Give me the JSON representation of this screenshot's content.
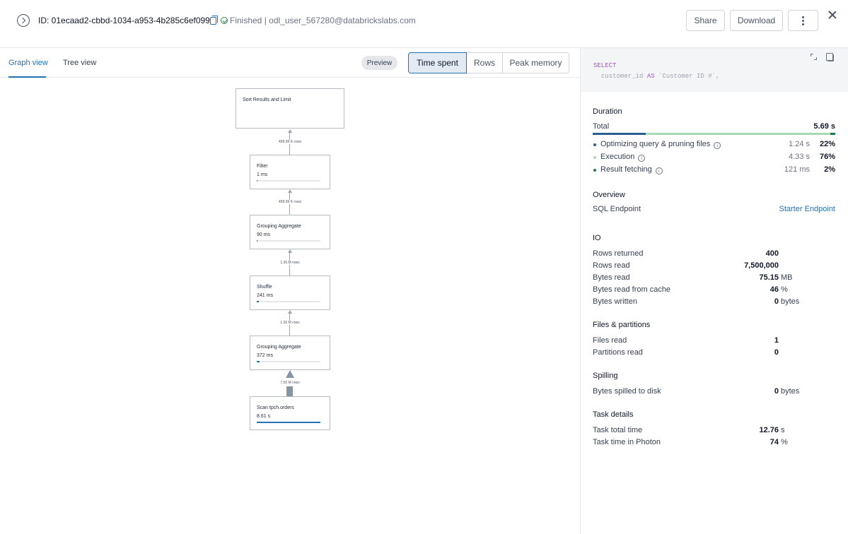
{
  "header": {
    "query_id": "ID: 01ecaad2-cbbd-1034-a953-4b285c6ef099",
    "status": "Finished | odl_user_567280@databrickslabs.com",
    "share_label": "Share",
    "download_label": "Download"
  },
  "tabs": {
    "graph_view": "Graph view",
    "tree_view": "Tree view",
    "preview": "Preview",
    "metrics": [
      "Time spent",
      "Rows",
      "Peak memory"
    ],
    "selected_metric": "Time spent"
  },
  "graph": {
    "nodes": [
      {
        "title": "Sort Results and Limit",
        "time": "",
        "bar_fraction": null
      },
      {
        "title": "Filter",
        "time": "1 ms",
        "bar_fraction": 0.01
      },
      {
        "title": "Grouping Aggregate",
        "time": "90 ms",
        "bar_fraction": 0.015
      },
      {
        "title": "Shuffle",
        "time": "241 ms",
        "bar_fraction": 0.03
      },
      {
        "title": "Grouping Aggregate",
        "time": "372 ms",
        "bar_fraction": 0.045
      },
      {
        "title": "Scan tpch.orders",
        "time": "8.61 s",
        "bar_fraction": 1.0
      }
    ],
    "edges": [
      "499.99 K rows",
      "499.99 K rows",
      "1.36 M rows",
      "1.36 M rows",
      "7.50 M rows"
    ]
  },
  "sql": {
    "line1": "SELECT",
    "line2_a": "customer_id ",
    "line2_kw": "AS",
    "line2_b": " `Customer ID #`,"
  },
  "duration": {
    "title": "Duration",
    "total_label": "Total",
    "total_value": "5.69 s",
    "colors": {
      "optimizing": "#2b5f8f",
      "execution": "#a7d9b5",
      "fetching": "#1f7a4c"
    },
    "items": [
      {
        "label": "Optimizing query & pruning files",
        "time": "1.24 s",
        "pct": "22%"
      },
      {
        "label": "Execution",
        "time": "4.33 s",
        "pct": "76%"
      },
      {
        "label": "Result fetching",
        "time": "121 ms",
        "pct": "2%"
      }
    ]
  },
  "overview": {
    "title": "Overview",
    "endpoint_label": "SQL Endpoint",
    "endpoint_value": "Starter Endpoint"
  },
  "io": {
    "title": "IO",
    "rows": [
      {
        "label": "Rows returned",
        "value": "400",
        "unit": ""
      },
      {
        "label": "Rows read",
        "value": "7,500,000",
        "unit": ""
      },
      {
        "label": "Bytes read",
        "value": "75.15",
        "unit": "MB"
      },
      {
        "label": "Bytes read from cache",
        "value": "46",
        "unit": "%"
      },
      {
        "label": "Bytes written",
        "value": "0",
        "unit": "bytes"
      }
    ]
  },
  "files": {
    "title": "Files & partitions",
    "rows": [
      {
        "label": "Files read",
        "value": "1",
        "unit": ""
      },
      {
        "label": "Partitions read",
        "value": "0",
        "unit": ""
      }
    ]
  },
  "spilling": {
    "title": "Spilling",
    "rows": [
      {
        "label": "Bytes spilled to disk",
        "value": "0",
        "unit": "bytes"
      }
    ]
  },
  "tasks": {
    "title": "Task details",
    "rows": [
      {
        "label": "Task total time",
        "value": "12.76",
        "unit": "s"
      },
      {
        "label": "Task time in Photon",
        "value": "74",
        "unit": "%"
      }
    ]
  }
}
